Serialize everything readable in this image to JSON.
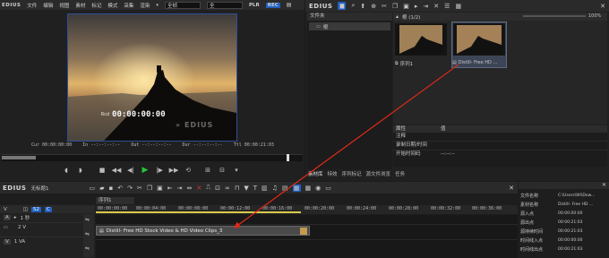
{
  "app_name": "EDIUS",
  "top_menu": {
    "items": [
      "文件",
      "编辑",
      "视图",
      "素材",
      "标记",
      "模式",
      "采集",
      "渲染"
    ],
    "render_dropdown": "全帧",
    "mode_dropdown": "全",
    "plr_label": "PLR",
    "rec_label": "REC"
  },
  "player": {
    "overlay_timecode": "00:00:00:00",
    "overlay_tc_label": "Rcd",
    "watermark": "EDIUS",
    "cur_label": "Cur",
    "cur_value": "00:00:00:00",
    "in_label": "In",
    "in_value": "--:--:--:--",
    "out_label": "Out",
    "out_value": "--:--:--:--",
    "dur_label": "Dur",
    "dur_value": "--:--:--:--",
    "ttl_label": "Ttl",
    "ttl_value": "00:00:21:03"
  },
  "bin": {
    "logo": "EDIUS",
    "tree_header": "文件夹",
    "folder_name": "根",
    "path_label": "根 (1/2)",
    "zoom": "100%",
    "clips": [
      {
        "name": "序列1"
      },
      {
        "name": "Distill- Free HD ..."
      }
    ],
    "props": {
      "col1": "属性",
      "col2": "值",
      "rows": [
        {
          "k": "注释",
          "v": ""
        },
        {
          "k": "录制日期/时间",
          "v": ""
        },
        {
          "k": "开始时间码",
          "v": "--:--:--"
        }
      ]
    },
    "tabs": [
      "素材库",
      "特效",
      "序列标记",
      "源文件浏览",
      "任务"
    ]
  },
  "timeline": {
    "logo": "EDIUS",
    "project": "无标题1",
    "sequence_tab": "序列1",
    "track_header_label": "V",
    "ruler": [
      "00:00:00:00",
      "00:00:04:00",
      "00:00:08:00",
      "00:00:12:00",
      "00:00:16:00",
      "00:00:20:00",
      "00:00:24:00",
      "00:00:28:00",
      "00:00:32:00",
      "00:00:36:00"
    ],
    "tracks": [
      {
        "name": "",
        "type": "A",
        "extra": "1 秒"
      },
      {
        "name": "2 V",
        "type": "",
        "extra": ""
      },
      {
        "name": "1 VA",
        "type": "V",
        "extra": ""
      }
    ],
    "clip_label": "Distill- Free HD Stock Video & HD Video Clips_3"
  },
  "info_panel": {
    "rows": [
      {
        "k": "文件名称",
        "v": "C:\\Users\\Wi\\Dow..."
      },
      {
        "k": "素材名称",
        "v": "Distill- Free HD ..."
      },
      {
        "k": "源入点",
        "v": "00:00:00:00"
      },
      {
        "k": "源出点",
        "v": "00:00:21:03"
      },
      {
        "k": "源持续时间",
        "v": "00:00:21:03"
      },
      {
        "k": "时间线入点",
        "v": "00:00:00:00"
      },
      {
        "k": "时间线出点",
        "v": "00:00:21:03"
      }
    ]
  },
  "colors": {
    "accent": "#1f5fbf",
    "arrow": "#e02a1a",
    "playhead": "#d8c94a"
  }
}
